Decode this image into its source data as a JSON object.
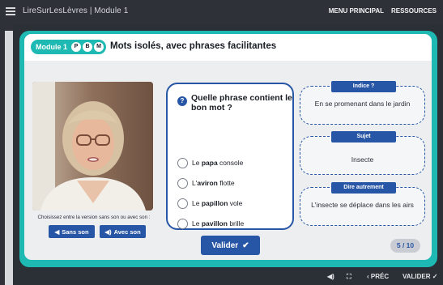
{
  "topbar": {
    "app_title": "LireSurLesLèvres | Module 1",
    "nav": [
      "MENU PRINCIPAL",
      "RESSOURCES"
    ]
  },
  "header": {
    "module_label": "Module 1",
    "letters": [
      "P",
      "B",
      "M"
    ],
    "title": "Mots isolés, avec phrases facilitantes"
  },
  "video": {
    "caption": "Choisissez entre la version sans son ou avec son :",
    "buttons": [
      {
        "icon": "speaker-muted-icon",
        "label": "Sans son"
      },
      {
        "icon": "speaker-sound-icon",
        "label": "Avec son"
      }
    ]
  },
  "question": {
    "icon": "question-icon",
    "text": "Quelle phrase contient le bon mot ?",
    "options": [
      {
        "prefix": "Le ",
        "word": "papa",
        "suffix": " console"
      },
      {
        "prefix": "L'",
        "word": "aviron",
        "suffix": " flotte"
      },
      {
        "prefix": "Le ",
        "word": "papillon",
        "suffix": " vole"
      },
      {
        "prefix": "Le ",
        "word": "pavillon",
        "suffix": " brille"
      }
    ]
  },
  "hints": [
    {
      "title": "Indice ?",
      "text": "En se promenant dans le jardin"
    },
    {
      "title": "Sujet",
      "text": "Insecte"
    },
    {
      "title": "Dire autrement",
      "text": "L'insecte se déplace dans les airs"
    }
  ],
  "validate_label": "Valider",
  "counter": "5 / 10",
  "bottom": {
    "prev_label": "PRÉC",
    "validate_label": "VALIDER"
  },
  "colors": {
    "accent": "#1fb9b3",
    "primary": "#2856a6",
    "frame": "#2e3138"
  }
}
